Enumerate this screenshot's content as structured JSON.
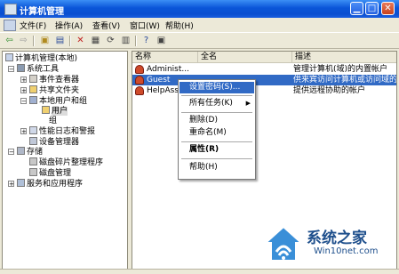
{
  "window": {
    "title": "计算机管理"
  },
  "menu": {
    "file": "文件(F)",
    "action": "操作(A)",
    "view": "查看(V)",
    "window": "窗口(W)",
    "help": "帮助(H)"
  },
  "tree": {
    "root": "计算机管理(本地)",
    "system_tools": "系统工具",
    "event_viewer": "事件查看器",
    "shared_folders": "共享文件夹",
    "local_users_groups": "本地用户和组",
    "users": "用户",
    "groups": "组",
    "perf_logs": "性能日志和警报",
    "device_manager": "设备管理器",
    "storage": "存储",
    "defrag": "磁盘碎片整理程序",
    "disk_mgmt": "磁盘管理",
    "services_apps": "服务和应用程序"
  },
  "list": {
    "columns": {
      "name": "名称",
      "fullname": "全名",
      "desc": "描述"
    },
    "rows": [
      {
        "name": "Administ...",
        "desc": "管理计算机(域)的内置帐户"
      },
      {
        "name": "Guest",
        "desc": "供来宾访问计算机或访问域的内"
      },
      {
        "name": "HelpAssi...",
        "desc": "提供远程协助的帐户"
      }
    ]
  },
  "context_menu": {
    "set_password": "设置密码(S)...",
    "all_tasks": "所有任务(K)",
    "delete": "删除(D)",
    "rename": "重命名(M)",
    "properties": "属性(R)",
    "help": "帮助(H)"
  },
  "watermark": {
    "brand": "系统之家",
    "url": "Win10net.com"
  },
  "colors": {
    "titlebar": "#0a55d8",
    "selection": "#316ac5",
    "chrome": "#ece9d8"
  }
}
